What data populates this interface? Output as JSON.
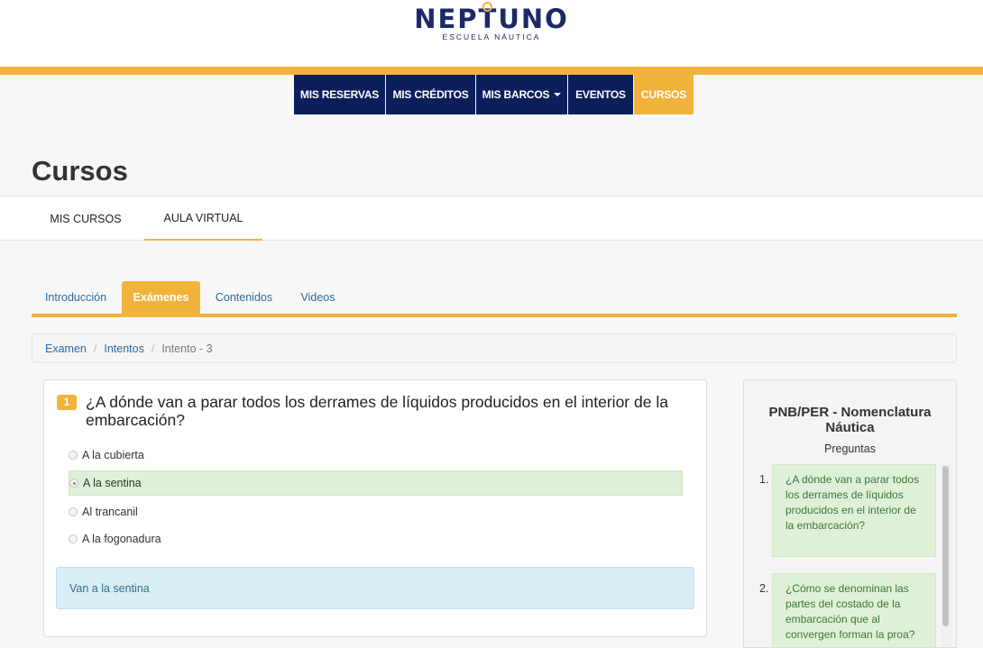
{
  "logo": {
    "name": "NEPTUNO",
    "tagline": "ESCUELA NÁUTICA"
  },
  "colors": {
    "navy": "#0c1f5c",
    "gold": "#f2b33d",
    "link": "#2c6aa0",
    "success_bg": "#dff0d8",
    "info_bg": "#d9edf7"
  },
  "nav": {
    "items": [
      {
        "label": "MIS RESERVAS"
      },
      {
        "label": "MIS CRÉDITOS"
      },
      {
        "label": "MIS BARCOS"
      },
      {
        "label": "EVENTOS"
      },
      {
        "label": "CURSOS"
      }
    ]
  },
  "page": {
    "title": "Cursos"
  },
  "subtabs": [
    {
      "label": "MIS CURSOS"
    },
    {
      "label": "AULA VIRTUAL"
    }
  ],
  "tabs": [
    {
      "label": "Introducción"
    },
    {
      "label": "Exámenes"
    },
    {
      "label": "Contenidos"
    },
    {
      "label": "Videos"
    }
  ],
  "breadcrumb": {
    "items": [
      "Examen",
      "Intentos"
    ],
    "separator": "/",
    "current": "Intento - 3"
  },
  "question": {
    "number": "1",
    "text": "¿A dónde van a parar todos los derrames de líquidos producidos en el interior de la embarcación?",
    "options": [
      "A la cubierta",
      "A la sentina",
      "Al trancanil",
      "A la fogonadura"
    ],
    "selected_index": 1,
    "answer": "Van a la sentina"
  },
  "sidebar": {
    "title": "PNB/PER - Nomenclatura Náutica",
    "subtitle": "Preguntas",
    "questions": [
      {
        "number": "1.",
        "text": "¿A dónde van a parar todos los derrames de líquidos producidos en el interior de la embarcación?"
      },
      {
        "number": "2.",
        "text": "¿Cómo se denominan las partes del costado de la embarcación que al convergen forman la proa?"
      }
    ]
  }
}
